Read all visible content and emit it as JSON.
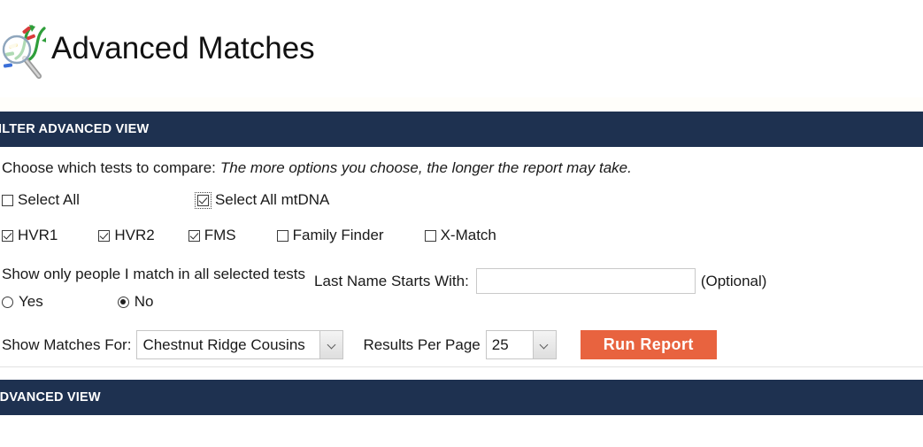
{
  "header": {
    "title": "Advanced Matches",
    "icon": "magnifier-dna-icon"
  },
  "filter_section": {
    "bar_label": "FILTER ADVANCED VIEW",
    "lead_text": "Choose which tests to compare:",
    "lead_hint": "The more options you choose, the longer the report may take.",
    "select_all": {
      "label": "Select All",
      "checked": false
    },
    "select_all_mtdna": {
      "label": "Select All mtDNA",
      "checked": true,
      "focused": true
    },
    "tests": [
      {
        "label": "HVR1",
        "checked": true
      },
      {
        "label": "HVR2",
        "checked": true
      },
      {
        "label": "FMS",
        "checked": true
      },
      {
        "label": "Family Finder",
        "checked": false
      },
      {
        "label": "X-Match",
        "checked": false
      }
    ],
    "match_all": {
      "label": "Show only people I match in all selected tests",
      "options": [
        {
          "label": "Yes",
          "selected": false
        },
        {
          "label": "No",
          "selected": true
        }
      ]
    },
    "last_name": {
      "label": "Last Name Starts With:",
      "value": "",
      "placeholder": "",
      "note": "(Optional)"
    },
    "show_matches_for": {
      "label": "Show Matches For:",
      "value": "Chestnut Ridge Cousins"
    },
    "results_per_page": {
      "label": "Results Per Page",
      "value": "25"
    },
    "run_report_button": "Run Report"
  },
  "results_section": {
    "bar_label": "ADVANCED VIEW"
  },
  "colors": {
    "bar_navy": "#1e3150",
    "accent_orange": "#e8633f",
    "panel_white": "#ffffff",
    "cream_band": "#fffefa"
  }
}
